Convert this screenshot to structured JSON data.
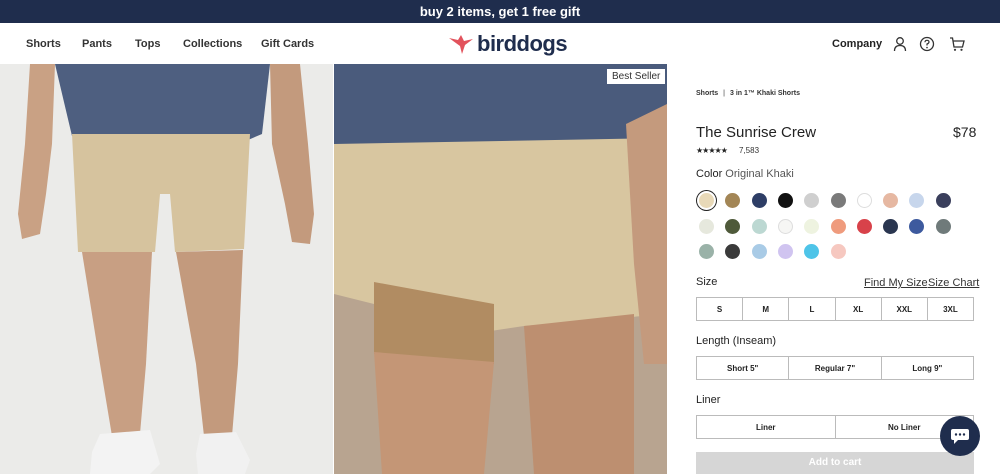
{
  "promo": {
    "text": "buy 2 items, get 1 free gift"
  },
  "nav": {
    "links": [
      "Shorts",
      "Pants",
      "Tops",
      "Collections",
      "Gift Cards"
    ],
    "logo_text": "birddogs",
    "company": "Company",
    "icons": [
      "user-icon",
      "help-icon",
      "cart-icon"
    ]
  },
  "gallery": {
    "badge": "Best Seller"
  },
  "breadcrumb": {
    "items": [
      "Shorts",
      "3 in 1™ Khaki Shorts"
    ],
    "separator": "|"
  },
  "product": {
    "title": "The Sunrise Crew",
    "price": "$78",
    "rating_stars": "★★★★★",
    "rating_value": 4.8,
    "review_count": "7,583",
    "color_label": "Color",
    "color_value": "Original Khaki"
  },
  "swatches": [
    [
      "#e8d9b8",
      "#a38656",
      "#2e3e66",
      "#111111",
      "#cfcfcf",
      "#7a7a7a",
      "#ffffff",
      "#e6b8a2",
      "#c7d6ec",
      "#3a3f5c"
    ],
    [
      "#e6e8dd",
      "#4f5a3a",
      "#bcd8d2",
      "#f6f6f4",
      "#eef3e0",
      "#ef9b7d",
      "#d8424a",
      "#2a3650",
      "#3d5a9e",
      "#6f7a7a"
    ],
    [
      "#9ab2a8",
      "#3a3a3a",
      "#a9cbe6",
      "#d0c4f0",
      "#4ec4e8",
      "#f6c8c0"
    ]
  ],
  "size": {
    "label": "Size",
    "find_link": "Find My Size",
    "chart_link": "Size Chart",
    "options": [
      "S",
      "M",
      "L",
      "XL",
      "XXL",
      "3XL"
    ]
  },
  "length": {
    "label": "Length (Inseam)",
    "options": [
      "Short 5\"",
      "Regular 7\"",
      "Long 9\""
    ]
  },
  "liner": {
    "label": "Liner",
    "options": [
      "Liner",
      "No Liner"
    ]
  },
  "add_to_cart": "Add to cart",
  "colors": {
    "navy": "#1f2d4d",
    "logo_bird": "#e2525c",
    "cart_disabled": "#d6d6d6"
  }
}
